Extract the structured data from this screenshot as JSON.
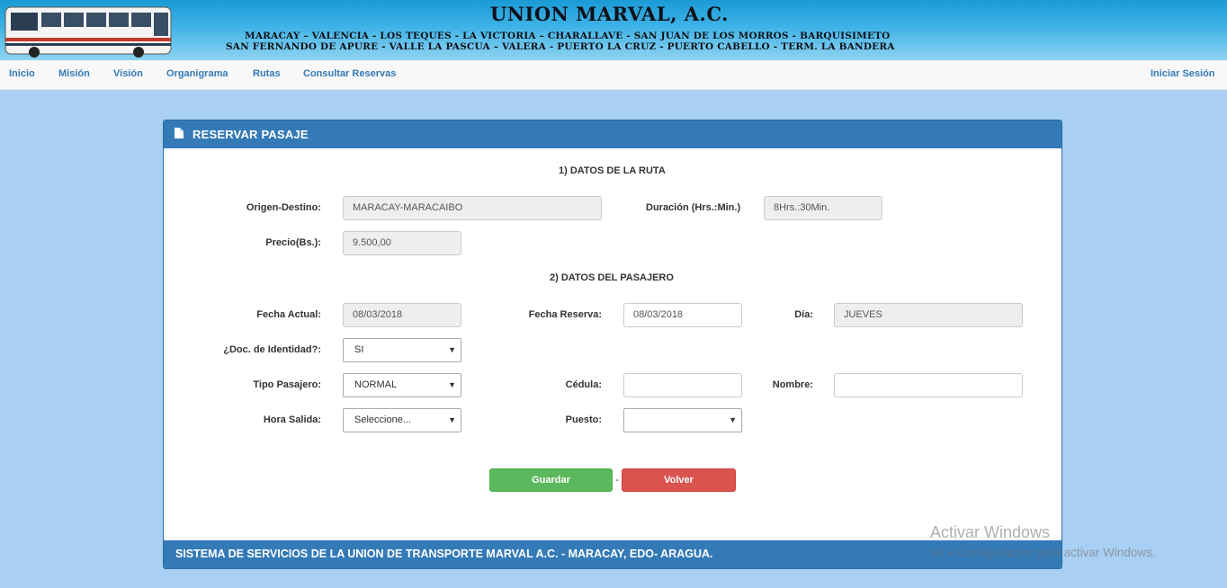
{
  "banner": {
    "company": "UNION MARVAL, A.C.",
    "routes_line1": "MARACAY – VALENCIA - LOS TEQUES - LA VICTORIA – CHARALLAVE - SAN JUAN DE LOS MORROS - BARQUISIMETO",
    "routes_line2": "SAN FERNANDO DE APURE - VALLE  LA PASCUA – VALERA - PUERTO LA CRUZ - PUERTO CABELLO - TERM. LA BANDERA"
  },
  "nav": {
    "items": [
      "Inicio",
      "Misión",
      "Visión",
      "Organigrama",
      "Rutas",
      "Consultar Reservas"
    ],
    "login": "Iniciar Sesión"
  },
  "panel": {
    "title": "RESERVAR PASAJE",
    "footer": "SISTEMA DE SERVICIOS DE LA UNION DE TRANSPORTE MARVAL A.C. - MARACAY, EDO- ARAGUA."
  },
  "ruta": {
    "section": "1) DATOS DE LA RUTA",
    "origen_label": "Origen-Destino:",
    "origen_value": "MARACAY-MARACAIBO",
    "duracion_label": "Duración (Hrs.:Min.)",
    "duracion_value": "8Hrs.:30Min.",
    "precio_label": "Precio(Bs.):",
    "precio_value": "9.500,00"
  },
  "pasajero": {
    "section": "2) DATOS DEL PASAJERO",
    "fecha_actual_label": "Fecha Actual:",
    "fecha_actual_value": "08/03/2018",
    "fecha_reserva_label": "Fecha Reserva:",
    "fecha_reserva_value": "08/03/2018",
    "dia_label": "Día:",
    "dia_value": "JUEVES",
    "doc_label": "¿Doc. de Identidad?:",
    "doc_value": "SI",
    "tipo_label": "Tipo Pasajero:",
    "tipo_value": "NORMAL",
    "cedula_label": "Cédula:",
    "cedula_value": "",
    "nombre_label": "Nombre:",
    "nombre_value": "",
    "hora_label": "Hora Salida:",
    "hora_value": "Seleccione...",
    "puesto_label": "Puesto:",
    "puesto_value": ""
  },
  "actions": {
    "save": "Guardar",
    "separator": "-",
    "back": "Volver"
  },
  "watermark": {
    "line1": "Activar Windows",
    "line2": "Ve a Configuración para activar Windows."
  },
  "colors": {
    "primary": "#337ab7",
    "success": "#5cb85c",
    "danger": "#d9534f",
    "page_bg": "#a9cff2"
  }
}
